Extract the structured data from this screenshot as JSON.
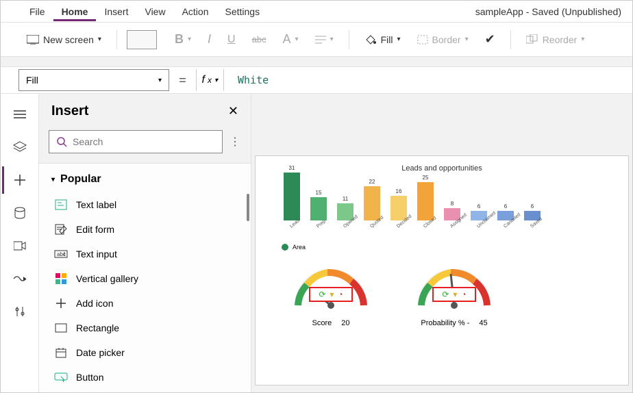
{
  "menu": {
    "items": [
      "File",
      "Home",
      "Insert",
      "View",
      "Action",
      "Settings"
    ],
    "active_index": 1
  },
  "app_status": "sampleApp - Saved (Unpublished)",
  "toolbar": {
    "new_screen": "New screen",
    "fill_label": "Fill",
    "border_label": "Border",
    "reorder_label": "Reorder"
  },
  "formula": {
    "property": "Fill",
    "value": "White"
  },
  "insert_panel": {
    "title": "Insert",
    "search_placeholder": "Search",
    "category": "Popular",
    "items": [
      {
        "label": "Text label",
        "icon": "text-label"
      },
      {
        "label": "Edit form",
        "icon": "edit-form"
      },
      {
        "label": "Text input",
        "icon": "text-input"
      },
      {
        "label": "Vertical gallery",
        "icon": "gallery"
      },
      {
        "label": "Add icon",
        "icon": "plus"
      },
      {
        "label": "Rectangle",
        "icon": "rect"
      },
      {
        "label": "Date picker",
        "icon": "date"
      },
      {
        "label": "Button",
        "icon": "button"
      }
    ]
  },
  "chart_data": {
    "type": "bar",
    "title": "Leads and opportunities",
    "categories": [
      "Lead",
      "Prep",
      "Opened",
      "Quoted",
      "Decided",
      "Closed",
      "Assigned",
      "Unclaimed",
      "Canceled",
      "Saved"
    ],
    "values": [
      31,
      15,
      11,
      22,
      16,
      25,
      8,
      6,
      6,
      6
    ],
    "colors": [
      "#2d8a56",
      "#4fb06f",
      "#7cc88a",
      "#f2b34b",
      "#f6cf6b",
      "#f2a43a",
      "#e98fb0",
      "#8fb4e6",
      "#7aa0db",
      "#6a8fcf"
    ],
    "legend": "Area"
  },
  "gauges": [
    {
      "label": "Score",
      "value": "20"
    },
    {
      "label": "Probability % -",
      "value": "45"
    }
  ]
}
